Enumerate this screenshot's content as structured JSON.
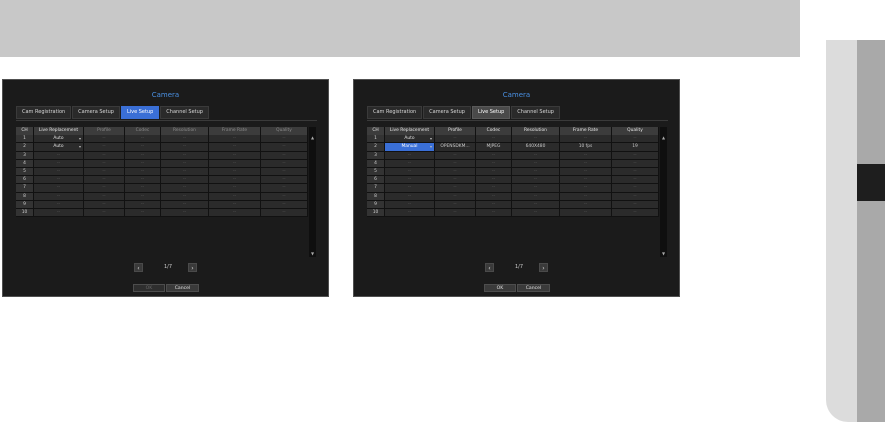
{
  "dialogs": [
    {
      "title": "Camera",
      "tabs": [
        "Cam Registration",
        "Camera Setup",
        "Live Setup",
        "Channel Setup"
      ],
      "active_tab": "Live Setup",
      "headers": [
        "CH",
        "Live Replacement",
        "Profile",
        "Codec",
        "Resolution",
        "Frame Rate",
        "Quality"
      ],
      "rows": [
        [
          "1",
          "Auto",
          "--",
          "--",
          "--",
          "--",
          "--"
        ],
        [
          "2",
          "Auto",
          "--",
          "--",
          "--",
          "--",
          "--"
        ],
        [
          "3",
          "--",
          "--",
          "--",
          "--",
          "--",
          "--"
        ],
        [
          "4",
          "--",
          "--",
          "--",
          "--",
          "--",
          "--"
        ],
        [
          "5",
          "--",
          "--",
          "--",
          "--",
          "--",
          "--"
        ],
        [
          "6",
          "--",
          "--",
          "--",
          "--",
          "--",
          "--"
        ],
        [
          "7",
          "--",
          "--",
          "--",
          "--",
          "--",
          "--"
        ],
        [
          "8",
          "--",
          "--",
          "--",
          "--",
          "--",
          "--"
        ],
        [
          "9",
          "--",
          "--",
          "--",
          "--",
          "--",
          "--"
        ],
        [
          "10",
          "--",
          "--",
          "--",
          "--",
          "--",
          "--"
        ]
      ],
      "page_text": "1/7",
      "ok_label": "OK",
      "cancel_label": "Cancel"
    },
    {
      "title": "Camera",
      "tabs": [
        "Cam Registration",
        "Camera Setup",
        "Live Setup",
        "Channel Setup"
      ],
      "active_tab": "Live Setup",
      "headers": [
        "CH",
        "Live Replacement",
        "Profile",
        "Codec",
        "Resolution",
        "Frame Rate",
        "Quality"
      ],
      "rows": [
        [
          "1",
          "Auto",
          "--",
          "--",
          "--",
          "--",
          "--"
        ],
        [
          "2",
          "Manual",
          "OPENSDKM...",
          "MJPEG",
          "640X480",
          "10 fps",
          "19"
        ],
        [
          "3",
          "--",
          "--",
          "--",
          "--",
          "--",
          "--"
        ],
        [
          "4",
          "--",
          "--",
          "--",
          "--",
          "--",
          "--"
        ],
        [
          "5",
          "--",
          "--",
          "--",
          "--",
          "--",
          "--"
        ],
        [
          "6",
          "--",
          "--",
          "--",
          "--",
          "--",
          "--"
        ],
        [
          "7",
          "--",
          "--",
          "--",
          "--",
          "--",
          "--"
        ],
        [
          "8",
          "--",
          "--",
          "--",
          "--",
          "--",
          "--"
        ],
        [
          "9",
          "--",
          "--",
          "--",
          "--",
          "--",
          "--"
        ],
        [
          "10",
          "--",
          "--",
          "--",
          "--",
          "--",
          "--"
        ]
      ],
      "page_text": "1/7",
      "ok_label": "OK",
      "cancel_label": "Cancel"
    }
  ],
  "colors": {
    "accent": "#3a6fd6",
    "title": "#4a90e2",
    "dialog_bg": "#1b1b1b",
    "topbar": "#c8c8c8"
  },
  "icons": {
    "prev": "chevron-left-icon",
    "next": "chevron-right-icon",
    "dropdown": "caret-down-icon"
  }
}
